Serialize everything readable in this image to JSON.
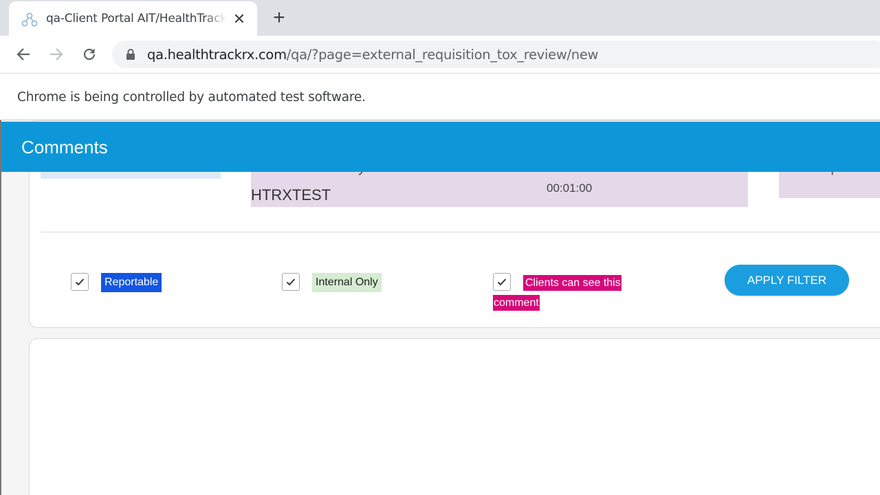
{
  "browser": {
    "tab": {
      "title": "qa-Client Portal AIT/HealthTrackRx"
    },
    "address": {
      "host": "qa.healthtrackrx.com",
      "path": "/qa/?page=external_requisition_tox_review/new"
    },
    "infobar": {
      "text": "Chrome is being controlled by automated test software."
    }
  },
  "page": {
    "header": {
      "title": "Comments"
    },
    "patient": {
      "label": "Patient: Baby",
      "name": "HTRXTEST",
      "time": "00:01:00"
    },
    "sample": {
      "label": "Sample"
    },
    "filters": {
      "reportable": {
        "label": "Reportable",
        "checked": true
      },
      "internal_only": {
        "label": "Internal Only",
        "checked": true
      },
      "clients_can_see": {
        "label": "Clients can see this comment",
        "checked": true
      },
      "apply_label": "APPLY FILTER"
    }
  },
  "colors": {
    "header": "#0d97d8",
    "reportable": "#1456e0",
    "internal_only": "#d6ecd2",
    "clients_can_see": "#d6097a",
    "apply_button": "#1a9ee0"
  },
  "icons": [
    "app-favicon-icon",
    "close-icon",
    "plus-icon",
    "back-arrow-icon",
    "forward-arrow-icon",
    "reload-icon",
    "lock-icon",
    "checkmark-icon"
  ]
}
